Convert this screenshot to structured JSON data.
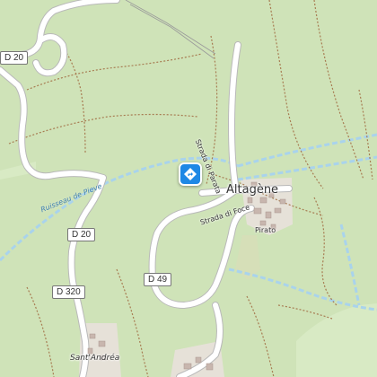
{
  "map": {
    "colors": {
      "forest": "#cfe3b8",
      "meadow": "#d8eac4",
      "road": "#ffffff",
      "road_casing": "#b9b9b9",
      "water": "#a9d3ec",
      "path": "#a77c52",
      "buildings": "#c8b6ae",
      "settlement": "#e6e1d8"
    },
    "road_labels": {
      "d20_top": "D 20",
      "d20_mid": "D 20",
      "d320": "D 320",
      "d49": "D 49"
    },
    "places": {
      "altagene": "Altagène",
      "sant_andrea": "Sant'Andréa"
    },
    "streets": {
      "strada_di_parata": "Strada di Parata",
      "strada_di_foce": "Strada di Foce",
      "pirato": "Pirato"
    },
    "water": {
      "ruisseau": "Ruisseau de Pieve"
    },
    "marker": {
      "icon": "directions-icon",
      "color": "#1e88e5"
    }
  }
}
